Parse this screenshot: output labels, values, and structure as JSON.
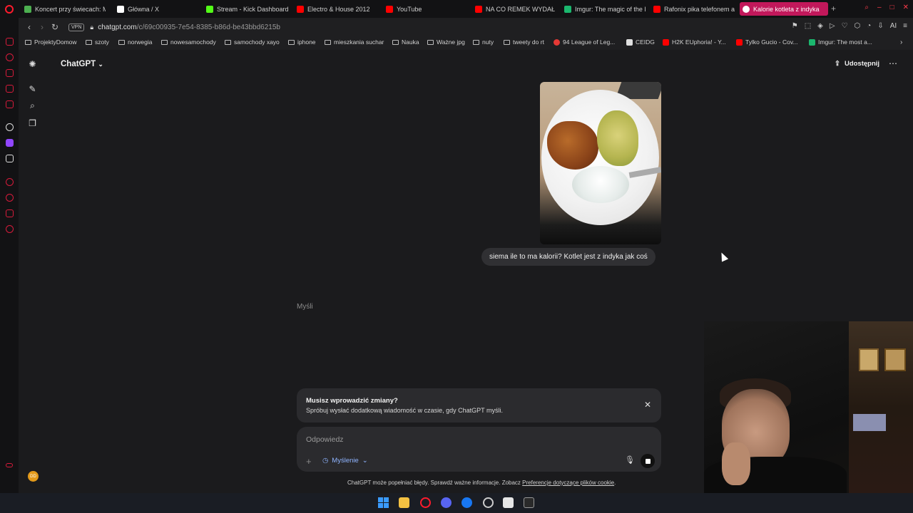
{
  "browser": {
    "tabs": [
      {
        "title": "Koncert przy świecach: M",
        "color": "#4caf50",
        "active": false
      },
      {
        "title": "Główna / X",
        "color": "#ffffff",
        "active": false
      },
      {
        "title": "Stream - Kick Dashboard",
        "color": "#53fc18",
        "active": false
      },
      {
        "title": "Electro & House 2012",
        "color": "#ff0000",
        "active": false
      },
      {
        "title": "YouTube",
        "color": "#ff0000",
        "active": false
      },
      {
        "title": "NA CO REMEK WYDAŁ O",
        "color": "#ff0000",
        "active": false
      },
      {
        "title": "Imgur: The magic of the I",
        "color": "#1bb76e",
        "active": false
      },
      {
        "title": "Rafonix pika telefonem a",
        "color": "#ff0000",
        "active": false
      },
      {
        "title": "Kalorie kotleta z indyka",
        "color": "#ffffff",
        "active": true
      }
    ],
    "url_host": "chatgpt.com",
    "url_path": "/c/69c00935-7e54-8385-b86d-be43bbd6215b",
    "vpn_label": "VPN",
    "ai_label": "AI",
    "bookmarks": [
      {
        "label": "ProjektyDomow",
        "type": "folder"
      },
      {
        "label": "szoty",
        "type": "folder"
      },
      {
        "label": "norwegia",
        "type": "folder"
      },
      {
        "label": "nowesamochody",
        "type": "folder"
      },
      {
        "label": "samochody xayo",
        "type": "folder"
      },
      {
        "label": "iphone",
        "type": "folder"
      },
      {
        "label": "mieszkania suchar",
        "type": "folder"
      },
      {
        "label": "Nauka",
        "type": "folder"
      },
      {
        "label": "Ważne jpg",
        "type": "folder"
      },
      {
        "label": "nuty",
        "type": "folder"
      },
      {
        "label": "tweety do rt",
        "type": "folder"
      },
      {
        "label": "94 League of Leg...",
        "type": "link",
        "color": "#e53935"
      },
      {
        "label": "CEIDG",
        "type": "link",
        "color": "#e0e0e0"
      },
      {
        "label": "H2K EUphoria! - Y...",
        "type": "link",
        "color": "#ff0000"
      },
      {
        "label": "Tylko Gucio - Cov...",
        "type": "link",
        "color": "#ff0000"
      },
      {
        "label": "Imgur: The most a...",
        "type": "link",
        "color": "#1bb76e"
      }
    ]
  },
  "app": {
    "title": "ChatGPT",
    "share_label": "Udostępnij",
    "user_message": "siema ile to ma kalorii? Kotlet jest z indyka jak coś",
    "thinking_label": "Myśli",
    "notice_title": "Musisz wprowadzić zmiany?",
    "notice_body": "Spróbuj wysłać dodatkową wiadomość w czasie, gdy ChatGPT myśli.",
    "composer_placeholder": "Odpowiedz",
    "mode_label": "Myślenie",
    "disclaimer_text": "ChatGPT może popełniać błędy. Sprawdź ważne informacje. Zobacz",
    "disclaimer_link": "Preferencje dotyczące plików cookie",
    "disclaimer_end": "."
  },
  "colors": {
    "accent_tab": "#c2185b",
    "opera_red": "#ff1b2d",
    "mode_blue": "#8fb4ff"
  }
}
